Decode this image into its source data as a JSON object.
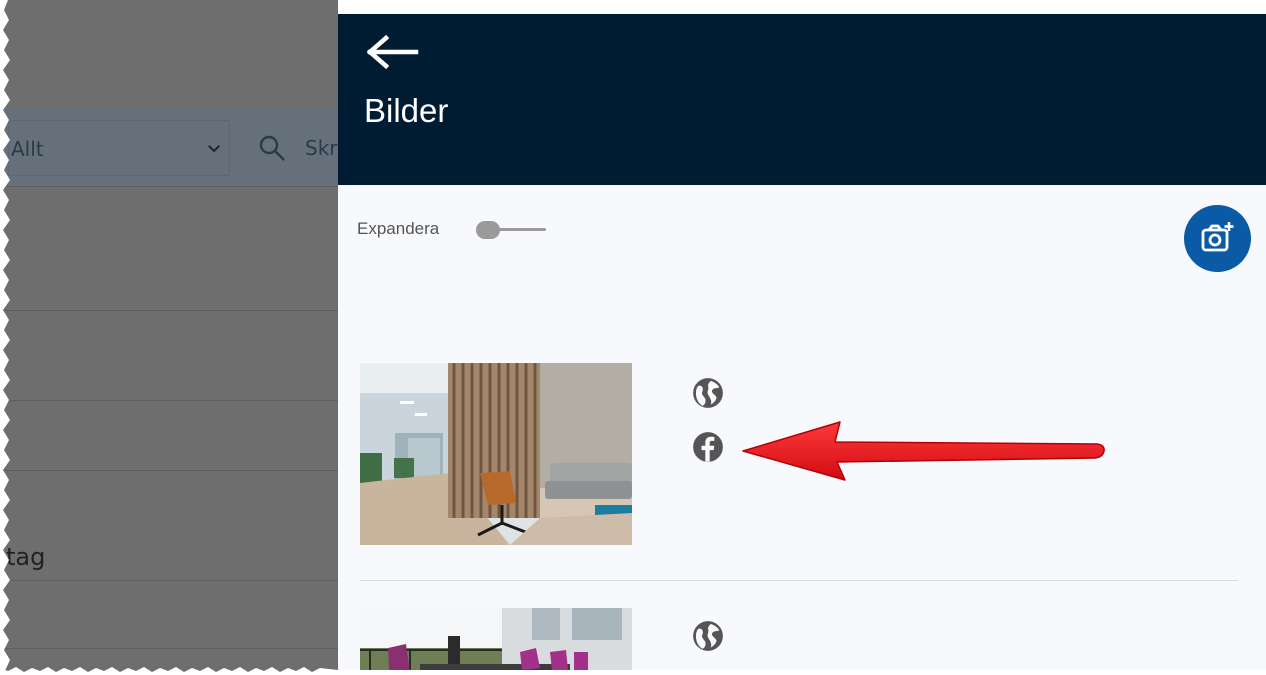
{
  "background": {
    "filter_select": {
      "value": "Allt"
    },
    "search": {
      "placeholder_partial": "Skr"
    },
    "partial_label": "tag"
  },
  "drawer": {
    "title": "Bilder",
    "expand_label": "Expandera",
    "expand_toggle_on": false,
    "images": [
      {
        "icons": [
          "globe-icon",
          "facebook-icon"
        ]
      },
      {
        "icons": [
          "globe-icon"
        ]
      }
    ]
  },
  "colors": {
    "header_bg": "#001c33",
    "accent_button": "#0a5aa6",
    "annotation_arrow": "#e8141b",
    "icon_grey": "#555555"
  }
}
